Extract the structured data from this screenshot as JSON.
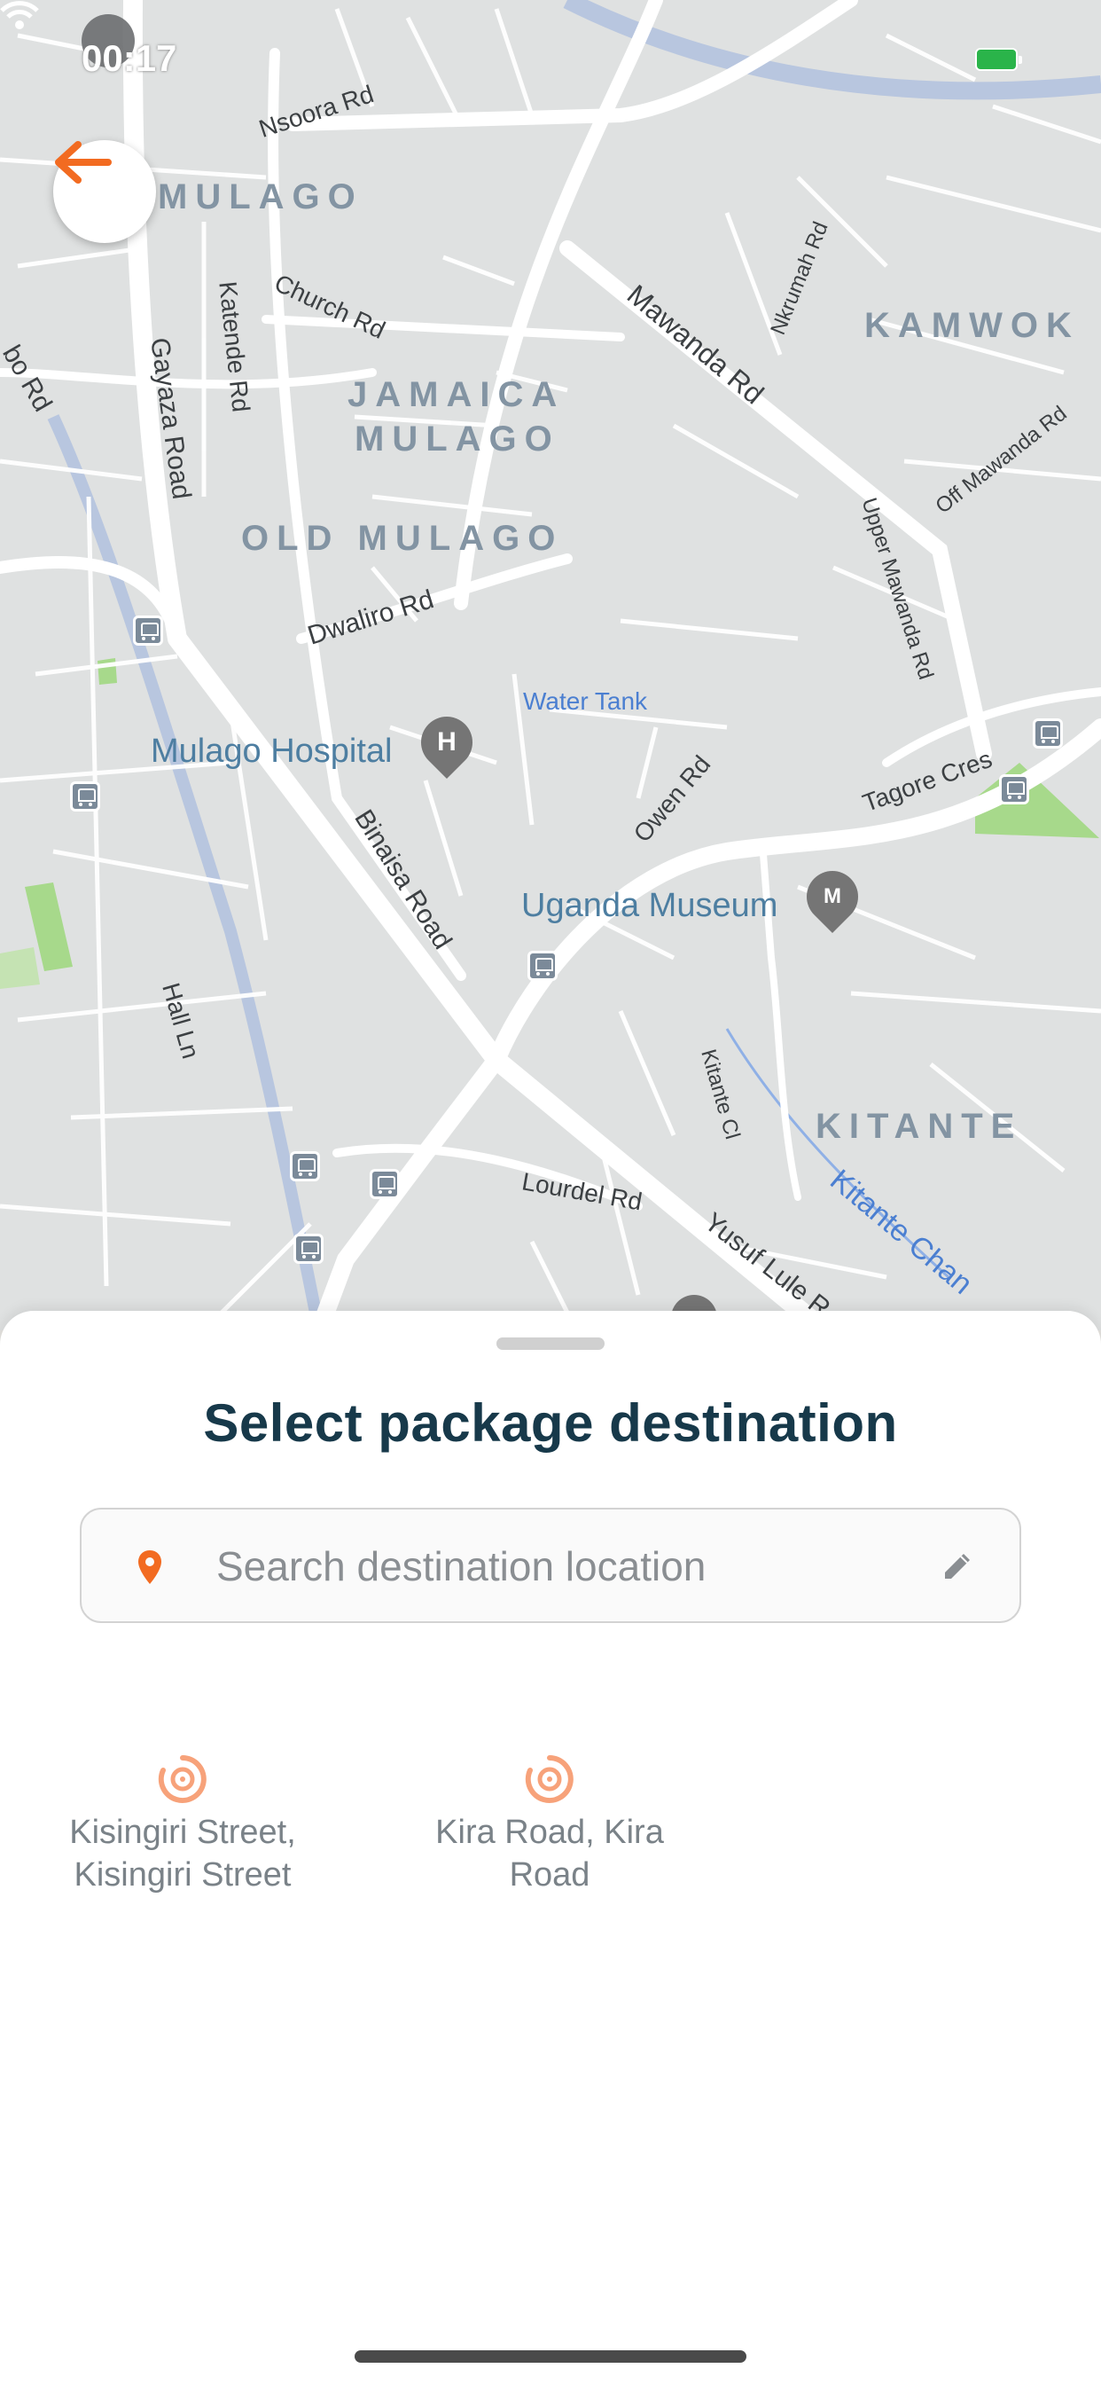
{
  "status_bar": {
    "time": "00:17",
    "icons": [
      "cart-icon",
      "wifi-icon",
      "battery-icon"
    ]
  },
  "back_button": {
    "icon": "arrow-left-icon",
    "color": "#f26b21"
  },
  "map": {
    "areas": {
      "mulago": "MULAGO",
      "kamwokya": "KAMWOK",
      "jamaica_mulago_1": "JAMAICA",
      "jamaica_mulago_2": "MULAGO",
      "old_mulago": "OLD MULAGO",
      "kitante": "KITANTE"
    },
    "roads": {
      "nsoora": "Nsoora Rd",
      "church": "Church Rd",
      "katende": "Katende Rd",
      "gayaza": "Gayaza Road",
      "mawanda": "Mawanda Rd",
      "nkrumah": "Nkrumah Rd",
      "off_mawanda": "Off Mawanda Rd",
      "upper_mawanda": "Upper Mawanda Rd",
      "dwaliro": "Dwaliro Rd",
      "binaisa": "Binaisa Road",
      "owen": "Owen Rd",
      "tagore": "Tagore Cres",
      "hall": "Hall Ln",
      "kitante_cl": "Kitante Cl",
      "lourdel": "Lourdel Rd",
      "yusuf_lule": "Yusuf Lule R",
      "bbo": "bo Rd"
    },
    "pois": {
      "mulago_hospital": "Mulago Hospital",
      "uganda_museum": "Uganda Museum",
      "water_tank": "Water Tank",
      "kitante_channel": "Kitante Chan"
    },
    "pin_glyphs": {
      "hospital": "H",
      "museum": "M"
    },
    "colors": {
      "land": "#dfe1e1",
      "road": "#ffffff",
      "park": "#a7d98b",
      "water": "#a9c1e6"
    }
  },
  "sheet": {
    "title": "Select package destination",
    "search": {
      "placeholder": "Search destination location",
      "value": "",
      "pin_icon": "location-pin-icon",
      "edit_icon": "pencil-icon"
    },
    "recent_locations": [
      {
        "label": "Kisingiri Street, Kisingiri Street",
        "icon": "history-icon"
      },
      {
        "label": "Kira Road, Kira Road",
        "icon": "history-icon"
      }
    ],
    "accent_color": "#f26b21"
  }
}
